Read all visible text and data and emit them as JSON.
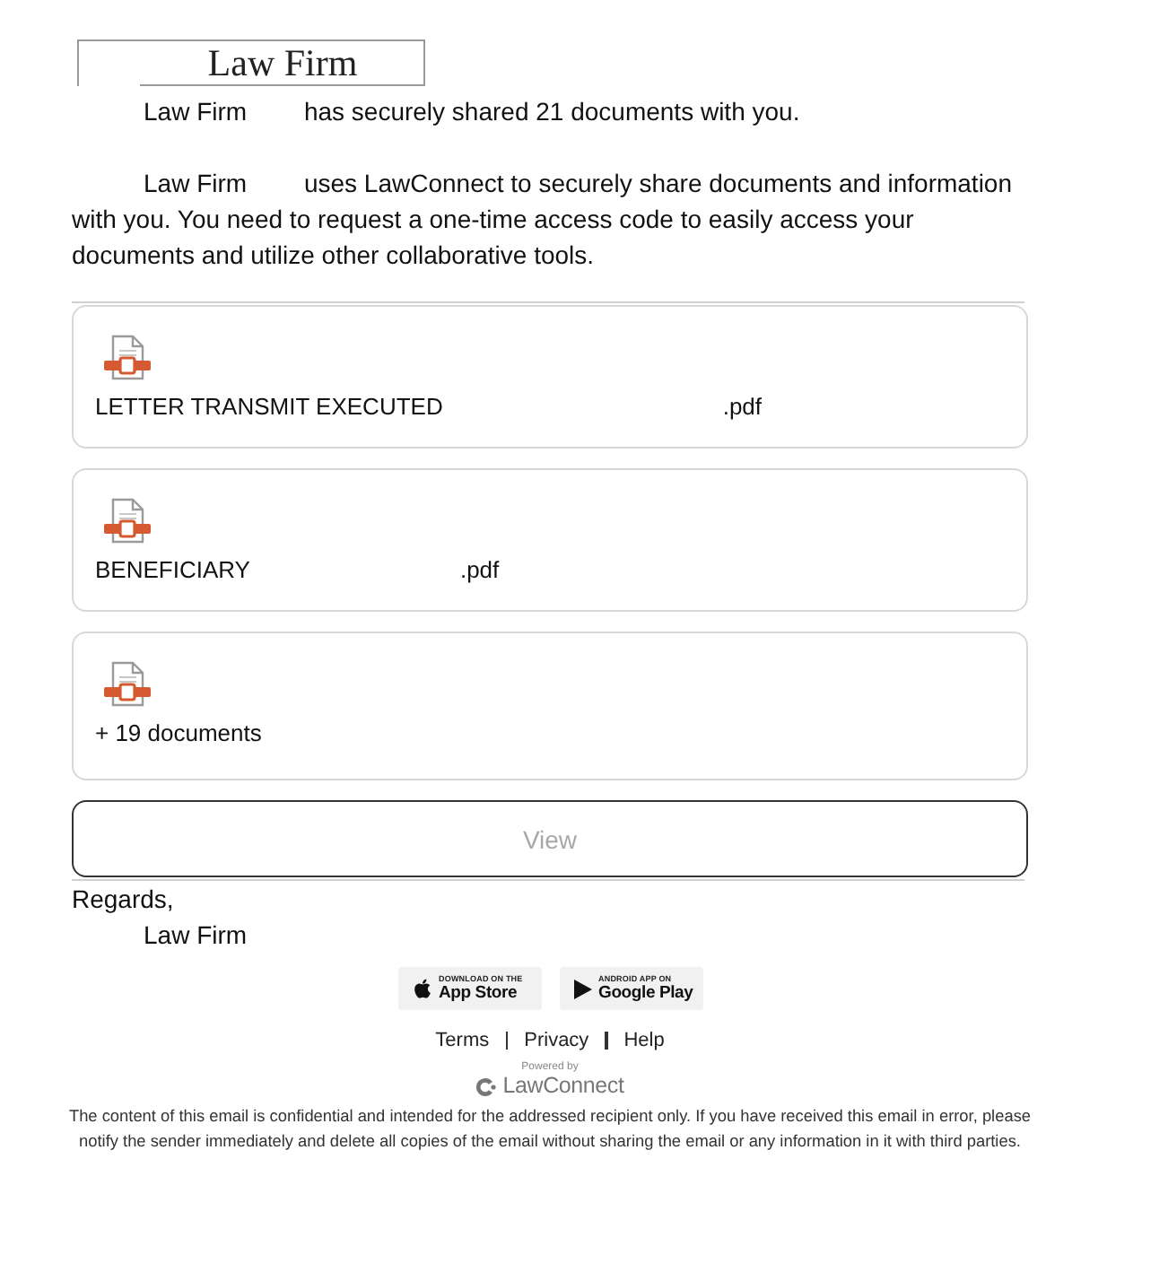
{
  "header": {
    "title": "Law Firm"
  },
  "intro": {
    "sender": "Law Firm",
    "text": "has securely shared 21 documents with you."
  },
  "description": {
    "sender": "Law Firm",
    "text": "uses LawConnect to securely share documents and information with you. You need to request a one-time access code to easily access your documents and utilize other collaborative tools."
  },
  "documents": [
    {
      "kind": "file",
      "name": "LETTER TRANSMIT EXECUTED",
      "extension": ".pdf"
    },
    {
      "kind": "file",
      "name": "BENEFICIARY",
      "extension": ".pdf"
    },
    {
      "kind": "more",
      "label": "+ 19 documents"
    }
  ],
  "view_button": {
    "label": "View"
  },
  "sign_off": {
    "closing": "Regards,",
    "signature": "Law Firm"
  },
  "app_badges": [
    {
      "kind": "apple",
      "caption": "DOWNLOAD ON THE",
      "label": "App Store"
    },
    {
      "kind": "google",
      "caption": "ANDROID APP ON",
      "label": "Google Play"
    }
  ],
  "footer_links": [
    "Terms",
    "Privacy",
    "Help"
  ],
  "powered_by": {
    "caption": "Powered by",
    "brand": "LawConnect"
  },
  "disclaimer": "The content of this email is confidential and intended for the addressed recipient only. If you have received this email in error, please notify the sender immediately and delete all copies of the email without sharing the email or any information in it with third parties."
}
